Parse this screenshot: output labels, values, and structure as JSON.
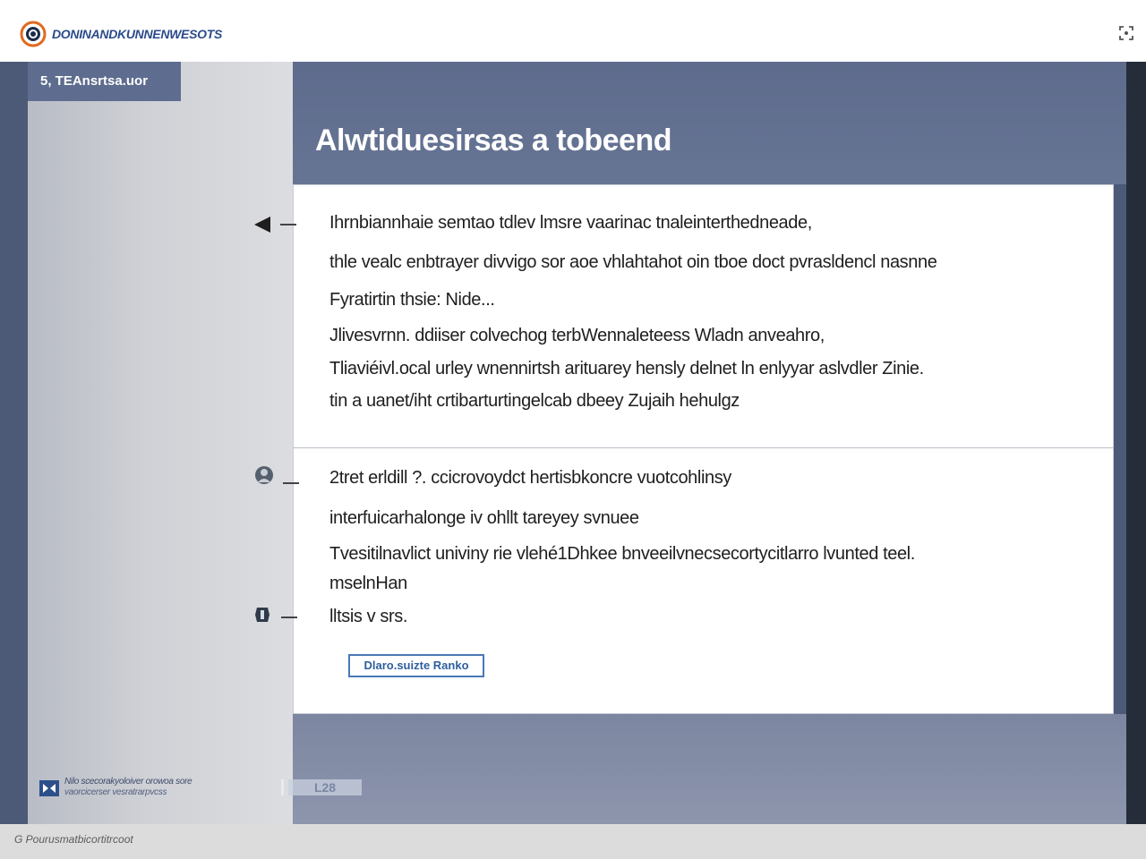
{
  "header": {
    "brand": "DONINANDKUNNENWESOTS"
  },
  "sidebar": {
    "section_label": "5, TEAnsrtsa.uor"
  },
  "slide": {
    "title": "Alwtiduesirsas a tobeend",
    "block1": {
      "lines": [
        "Ihrnbiannhaie semtao tdlev lmsre vaarinac tnaleinterthedneade,",
        "thle vealc enbtrayer divvigo sor aoe vhlahtahot oin tboe doct pvrasldencl nasnne",
        "Fyratirtin thsie: Nide...",
        "Jlivesvrnn. ddiiser colvechog terbWennaleteess Wladn anveahro,",
        "Tliaviéivl.ocal urley wnennirtsh arituarey hensly delnet ln enlyyar aslvdler Zinie.",
        "tin a uanet/iht crtibarturtingelcab dbeey Zujaih hehulgz"
      ]
    },
    "block2": {
      "lines": [
        "2tret erldill ?. ccicrovoydct hertisbkoncre vuotcohlinsy",
        "interfuicarhalonge iv ohllt tareyey svnuee",
        "Tvesitilnavlict univiny rie vlehé1Dhkee bnveeilvnecsecortycitlarro lvunted teel.",
        "mselnHan",
        "lltsis v srs."
      ]
    },
    "source_button": "Dlaro.suizte Ranko"
  },
  "footer": {
    "line1": "Nilo scecorakyoloiver orowoa sore",
    "line2": "vaorcicerser vesratrarpvcss",
    "badge": "L28"
  },
  "status": {
    "text": "G Pourusmatbicortitrcoot"
  }
}
